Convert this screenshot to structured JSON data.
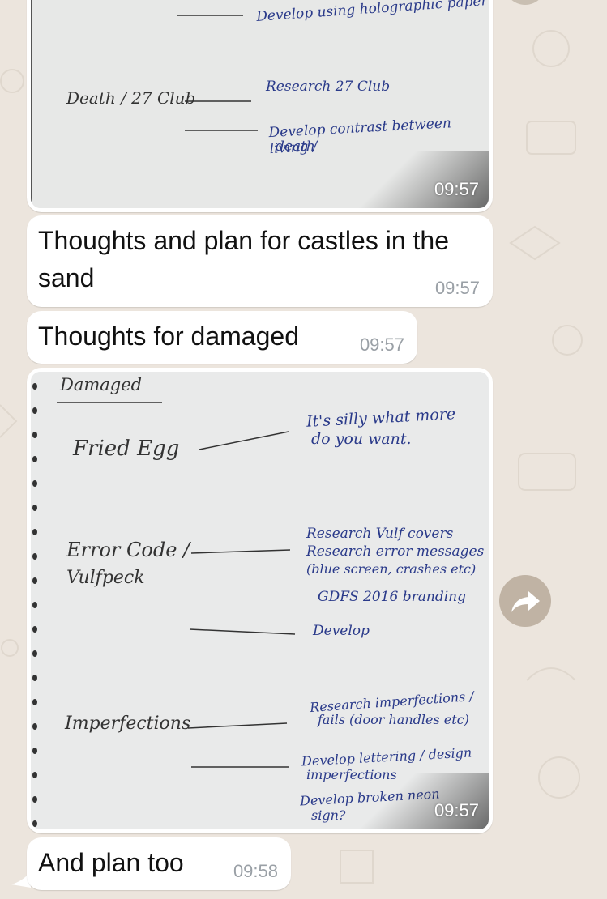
{
  "chat": {
    "messages": [
      {
        "type": "image",
        "time": "09:57",
        "note": {
          "top_line": "Develop using holographic paper",
          "left_label": "Death / 27 Club",
          "item1": "Research 27 Club",
          "item2_line1": "Develop contrast between living /",
          "item2_line2": "death"
        }
      },
      {
        "type": "text",
        "text": "Thoughts and plan for castles in the sand",
        "time": "09:57"
      },
      {
        "type": "text",
        "text": "Thoughts for damaged",
        "time": "09:57"
      },
      {
        "type": "image",
        "time": "09:57",
        "note": {
          "heading": "Damaged",
          "fried_egg": "Fried Egg",
          "fried_egg_note_1": "It's silly what more",
          "fried_egg_note_2": "do you want.",
          "error_code_1": "Error Code /",
          "error_code_2": "Vulfpeck",
          "error_note_1": "Research Vulf covers",
          "error_note_2": "Research error messages",
          "error_note_3": "(blue screen, crashes etc)",
          "error_note_4": "GDFS 2016 branding",
          "error_develop": "Develop",
          "imperfections": "Imperfections",
          "imp_note_1": "Research imperfections /",
          "imp_note_2": "fails (door handles etc)",
          "imp_note_3": "Develop lettering / design",
          "imp_note_4": "imperfections",
          "imp_note_5": "Develop broken neon",
          "imp_note_6": "sign?"
        }
      },
      {
        "type": "text",
        "text": "And plan too",
        "time": "09:58"
      }
    ]
  },
  "icons": {
    "forward": "forward-arrow-icon"
  },
  "colors": {
    "wallpaper": "#ece5dd",
    "bubble": "#ffffff",
    "ink": "#2a3a8a",
    "pencil": "#333333"
  }
}
